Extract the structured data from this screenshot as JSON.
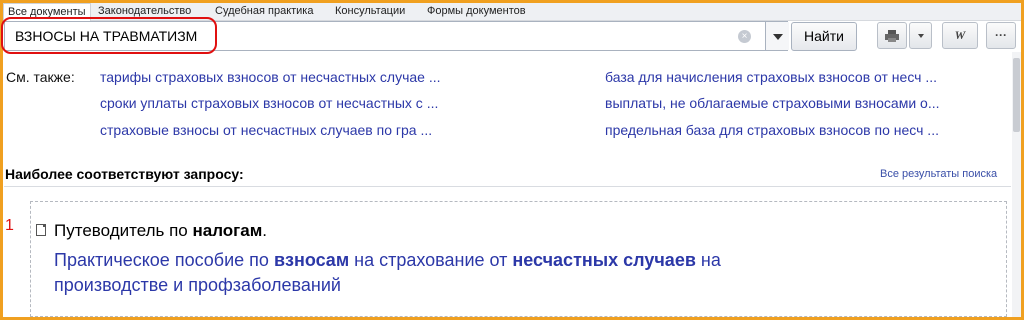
{
  "tabs": [
    {
      "label": "Все документы",
      "active": true
    },
    {
      "label": "Законодательство"
    },
    {
      "label": "Судебная практика"
    },
    {
      "label": "Консультации"
    },
    {
      "label": "Формы документов"
    }
  ],
  "search": {
    "value": "ВЗНОСЫ НА ТРАВМАТИЗМ",
    "find_label": "Найти",
    "clear_icon": "clear-icon",
    "dropdown_icon": "chevron-down-icon"
  },
  "toolbar": {
    "print_icon": "printer-icon",
    "word_label": "W",
    "more_label": "···"
  },
  "see_also": {
    "label": "См. также:",
    "links": [
      "тарифы страховых взносов от несчастных случае ...",
      "сроки уплаты страховых взносов от несчастных с ...",
      "страховые взносы от несчастных случаев по гра ...",
      "база для начисления страховых взносов от несч ...",
      "выплаты, не облагаемые страховыми взносами о...",
      "предельная база для страховых взносов по несч ..."
    ]
  },
  "results": {
    "heading": "Наиболее соответствуют запросу:",
    "all_results": "Все результаты поиска",
    "items": [
      {
        "number": "1",
        "title_plain": "Путеводитель по ",
        "title_bold": "налогам",
        "title_end": ".",
        "desc_1": "Практическое пособие по ",
        "desc_bold_1": "взносам",
        "desc_2": " на страхование от ",
        "desc_bold_2": "несчастных случаев",
        "desc_3": " на производстве и профзаболеваний"
      }
    ]
  },
  "colors": {
    "frame": "#f0a020",
    "highlight_ring": "#e01010",
    "link": "#2c38a8"
  }
}
